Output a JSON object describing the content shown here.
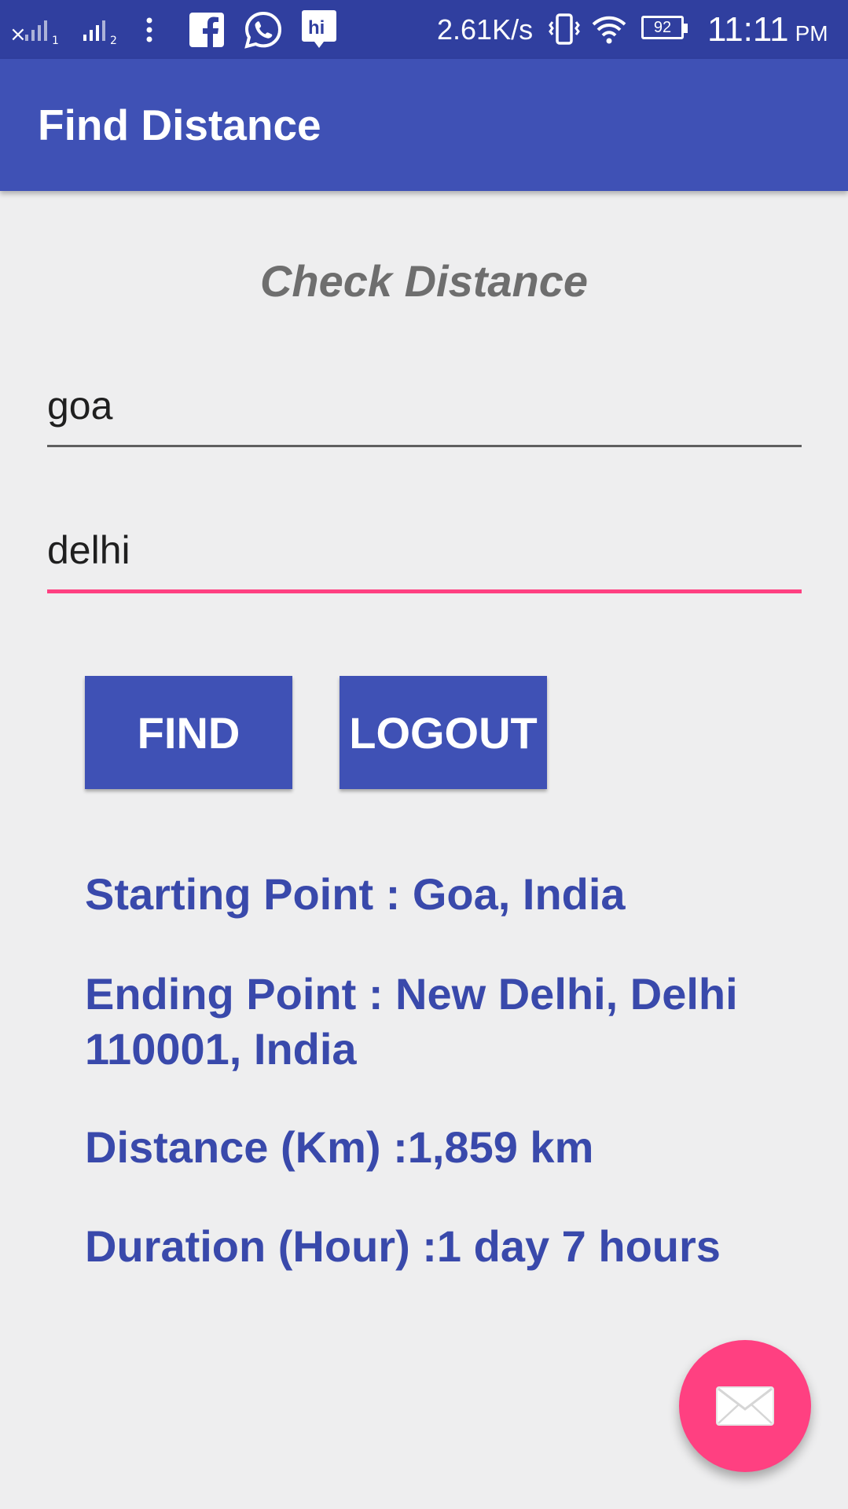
{
  "status_bar": {
    "sim1_label": "1",
    "sim2_label": "2",
    "network_speed": "2.61K/s",
    "battery_level": "92",
    "time": "11:11",
    "ampm": "PM",
    "icons": [
      "signal-sim1-icon",
      "signal-sim2-icon",
      "more-vert-icon",
      "facebook-icon",
      "whatsapp-icon",
      "hike-icon",
      "vibrate-icon",
      "wifi-icon",
      "battery-icon"
    ]
  },
  "app_bar": {
    "title": "Find Distance"
  },
  "form": {
    "heading": "Check Distance",
    "origin_value": "goa",
    "destination_value": "delhi",
    "find_label": "FIND",
    "logout_label": "LOGOUT"
  },
  "results": {
    "starting_point": "Starting Point : Goa, India",
    "ending_point": "Ending Point : New Delhi, Delhi 110001, India",
    "distance": "Distance (Km) :1,859 km",
    "duration": "Duration (Hour) :1 day 7 hours"
  },
  "fab": {
    "icon": "email-icon"
  },
  "colors": {
    "status_bar": "#303f9f",
    "primary": "#3f51b5",
    "accent": "#ff4081",
    "result_text": "#3949ab",
    "background": "#eeeeef"
  }
}
